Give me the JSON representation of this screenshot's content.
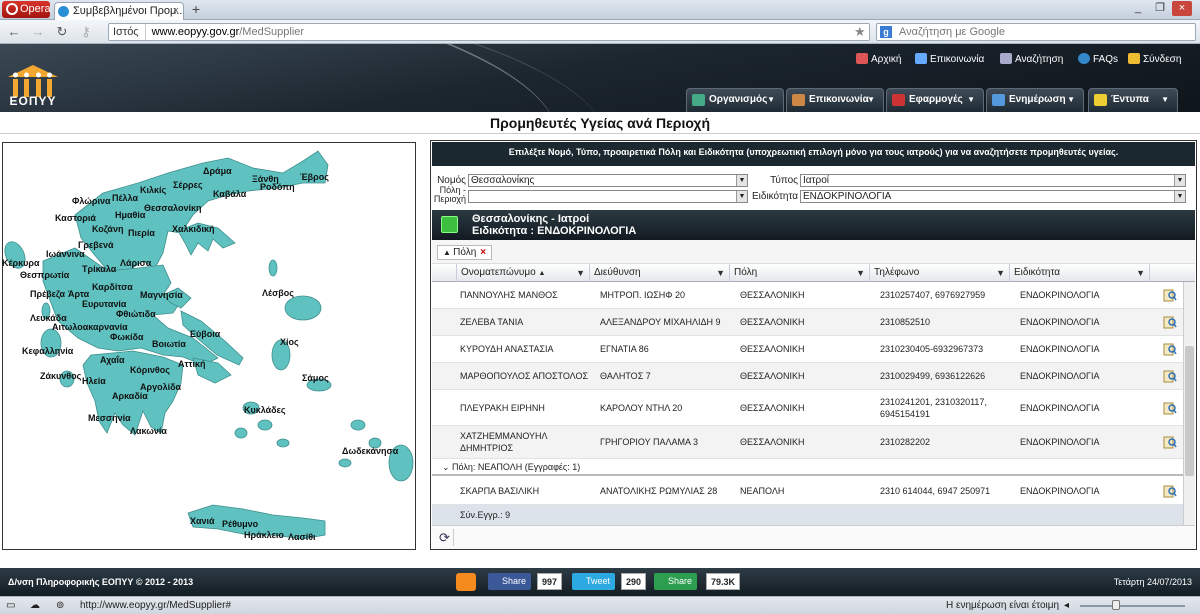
{
  "browser": {
    "menu_button": "Opera",
    "tab_title": "Συμβεβλημένοι Προμ...",
    "info_label": "Ιστός",
    "url_host": "www.eopyy.gov.gr",
    "url_path": "/MedSupplier",
    "search_placeholder": "Αναζήτηση με Google",
    "status_url": "http://www.eopyy.gr/MedSupplier#",
    "status_update": "Η ενημέρωση είναι έτοιμη"
  },
  "header": {
    "logo_text": "ΕΟΠΥΥ",
    "top_links": [
      "Αρχική",
      "Επικοινωνία",
      "Αναζήτηση",
      "FAQs",
      "Σύνδεση"
    ],
    "menu": [
      "Οργανισμός",
      "Επικοινωνία",
      "Εφαρμογές",
      "Ενημέρωση",
      "Έντυπα"
    ]
  },
  "page_title": "Προμηθευτές Υγείας ανά Περιοχή",
  "map": {
    "fill_color": "#5fc2c0",
    "labels": [
      "Δράμα",
      "Ξάνθη",
      "Σέρρες",
      "Κιλκίς",
      "Καβάλα",
      "Ροδόπη",
      "Έβρος",
      "Πέλλα",
      "Φλώρινα",
      "Θεσσαλονίκη",
      "Ημαθία",
      "Καστοριά",
      "Κοζάνη",
      "Πιερία",
      "Χαλκιδική",
      "Γρεβενά",
      "Ιωάννινα",
      "Κέρκυρα",
      "Θεσπρωτία",
      "Λάρισα",
      "Τρίκαλα",
      "Καρδίτσα",
      "Πρέβεζα",
      "Άρτα",
      "Μαγνησία",
      "Ευρυτανία",
      "Λέσβος",
      "Φθιώτιδα",
      "Λευκάδα",
      "Αιτωλοακαρνανία",
      "Φωκίδα",
      "Εύβοια",
      "Βοιωτία",
      "Χίος",
      "Κεφαλληνία",
      "Αχαΐα",
      "Αττική",
      "Ζάκυνθος",
      "Κόρινθος",
      "Σάμος",
      "Ηλεία",
      "Αργολίδα",
      "Αρκαδία",
      "Κυκλάδες",
      "Μεσσηνία",
      "Λακωνία",
      "Δωδεκάνησα",
      "Χανιά",
      "Ρέθυμνο",
      "Ηράκλειο",
      "Λασίθι"
    ]
  },
  "filters": {
    "instruction": "Επιλέξτε Νομό, Τύπο, προαιρετικά Πόλη και Ειδικότητα  (υποχρεωτική επιλογή μόνο για τους ιατρούς) για να αναζητήσετε προμηθευτές υγείας.",
    "prefecture_label": "Νομός",
    "prefecture_value": "Θεσσαλονίκης",
    "type_label": "Τύπος",
    "type_value": "Ιατροί",
    "city_label_1": "Πόλη -",
    "city_label_2": "Περιοχή",
    "city_value": "",
    "specialty_label": "Ειδικότητα",
    "specialty_value": "ΕΝΔΟΚΡΙΝΟΛΟΓΙΑ"
  },
  "results": {
    "title_line1": "Θεσσαλονίκης -  Ιατροί",
    "title_line2": "Ειδικότητα : ΕΝΔΟΚΡΙΝΟΛΟΓΙΑ",
    "group_tag": "Πόλη",
    "columns": [
      "Ονοματεπώνυμο",
      "Διεύθυνση",
      "Πόλη",
      "Τηλέφωνο",
      "Ειδικότητα"
    ],
    "sort_indicator": "▲",
    "rows": [
      [
        "ΠΑΝΝΟΥΛΗΣ ΜΑΝΘΟΣ",
        "ΜΗΤΡΟΠ. ΙΩΣΗΦ 20",
        "ΘΕΣΣΑΛΟΝΙΚΗ",
        "2310257407, 6976927959",
        "ΕΝΔΟΚΡΙΝΟΛΟΓΙΑ"
      ],
      [
        "ΖΕΛΕΒΑ ΤΑΝΙΑ",
        "ΑΛΕΞΑΝΔΡΟΥ ΜΙΧΑΗΛΙΔΗ 9",
        "ΘΕΣΣΑΛΟΝΙΚΗ",
        "2310852510",
        "ΕΝΔΟΚΡΙΝΟΛΟΓΙΑ"
      ],
      [
        "ΚΥΡΟΥΔΗ ΑΝΑΣΤΑΣΙΑ",
        "ΕΓΝΑΤΙΑ 86",
        "ΘΕΣΣΑΛΟΝΙΚΗ",
        "2310230405-6932967373",
        "ΕΝΔΟΚΡΙΝΟΛΟΓΙΑ"
      ],
      [
        "ΜΑΡΘΟΠΟΥΛΟΣ ΑΠΟΣΤΟΛΟΣ",
        "ΘΑΛΗΤΟΣ 7",
        "ΘΕΣΣΑΛΟΝΙΚΗ",
        "2310029499, 6936122626",
        "ΕΝΔΟΚΡΙΝΟΛΟΓΙΑ"
      ],
      [
        "ΠΛΕΥΡΑΚΗ ΕΙΡΗΝΗ",
        "ΚΑΡΟΛΟΥ ΝΤΗΛ 20",
        "ΘΕΣΣΑΛΟΝΙΚΗ",
        "2310241201, 2310320117, 6945154191",
        "ΕΝΔΟΚΡΙΝΟΛΟΓΙΑ"
      ],
      [
        "ΧΑΤΖΗΕΜΜΑΝΟΥΗΛ ΔΗΜΗΤΡΙΟΣ",
        "ΓΡΗΓΟΡΙΟΥ ΠΑΛΑΜΑ 3",
        "ΘΕΣΣΑΛΟΝΙΚΗ",
        "2310282202",
        "ΕΝΔΟΚΡΙΝΟΛΟΓΙΑ"
      ]
    ],
    "group2_label": "Πόλη: ΝΕΑΠΟΛΗ (Εγγραφές: 1)",
    "group2_rows": [
      [
        "ΣΚΑΡΠΑ ΒΑΣΙΛΙΚΗ",
        "ΑΝΑΤΟΛΙΚΗΣ ΡΩΜΥΛΙΑΣ 28",
        "ΝΕΑΠΟΛΗ",
        "2310 614044, 6947 250971",
        "ΕΝΔΟΚΡΙΝΟΛΟΓΙΑ"
      ]
    ],
    "summary": "Σύν.Εγγρ.: 9"
  },
  "footer": {
    "copyright": "Δ/νση Πληροφορικής ΕΟΠΥΥ © 2012 - 2013",
    "fb_label": "Share",
    "fb_count": "997",
    "tw_label": "Tweet",
    "tw_count": "290",
    "sh_label": "Share",
    "sh_count": "79.3K",
    "date": "Τετάρτη 24/07/2013"
  }
}
